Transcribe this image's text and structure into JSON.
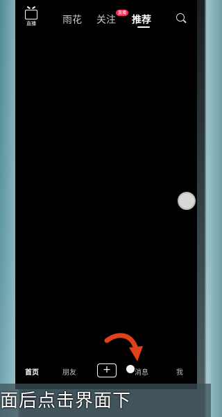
{
  "topbar": {
    "live_label": "直播",
    "tabs": [
      {
        "label": "雨花"
      },
      {
        "label": "关注"
      },
      {
        "label": "推荐"
      }
    ],
    "badge_text": "直播"
  },
  "bottom_nav": {
    "items": [
      "首页",
      "朋友",
      "+",
      "消息",
      "我"
    ]
  },
  "caption": "面后点击界面下",
  "colors": {
    "badge": "#fe2c55",
    "arrow": "#e0401a",
    "background": "#000000"
  }
}
